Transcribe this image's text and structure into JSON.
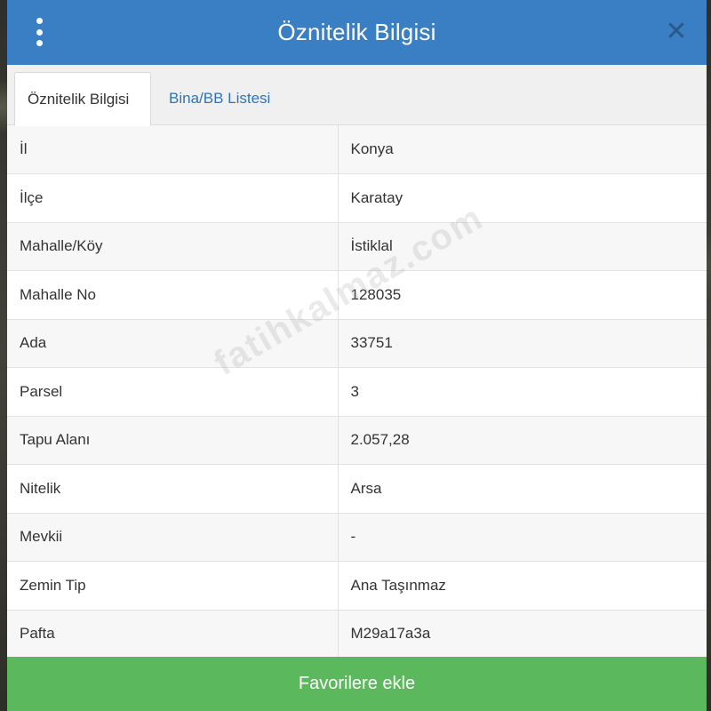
{
  "header": {
    "title": "Öznitelik Bilgisi",
    "menu_icon": "kebab-menu-icon",
    "close_icon": "close-icon",
    "color": "#3a7fc3"
  },
  "tabs": [
    {
      "label": "Öznitelik Bilgisi",
      "active": true
    },
    {
      "label": "Bina/BB Listesi",
      "active": false
    }
  ],
  "attributes": [
    {
      "key": "İl",
      "value": "Konya"
    },
    {
      "key": "İlçe",
      "value": "Karatay"
    },
    {
      "key": "Mahalle/Köy",
      "value": "İstiklal"
    },
    {
      "key": "Mahalle No",
      "value": "128035"
    },
    {
      "key": "Ada",
      "value": "33751"
    },
    {
      "key": "Parsel",
      "value": "3"
    },
    {
      "key": "Tapu Alanı",
      "value": "2.057,28"
    },
    {
      "key": "Nitelik",
      "value": "Arsa"
    },
    {
      "key": "Mevkii",
      "value": "-"
    },
    {
      "key": "Zemin Tip",
      "value": "Ana Taşınmaz"
    },
    {
      "key": "Pafta",
      "value": "M29a17a3a"
    }
  ],
  "footer": {
    "favorite_label": "Favorilere ekle",
    "color": "#5cb85c"
  },
  "watermark": "fatihkalmaz.com"
}
